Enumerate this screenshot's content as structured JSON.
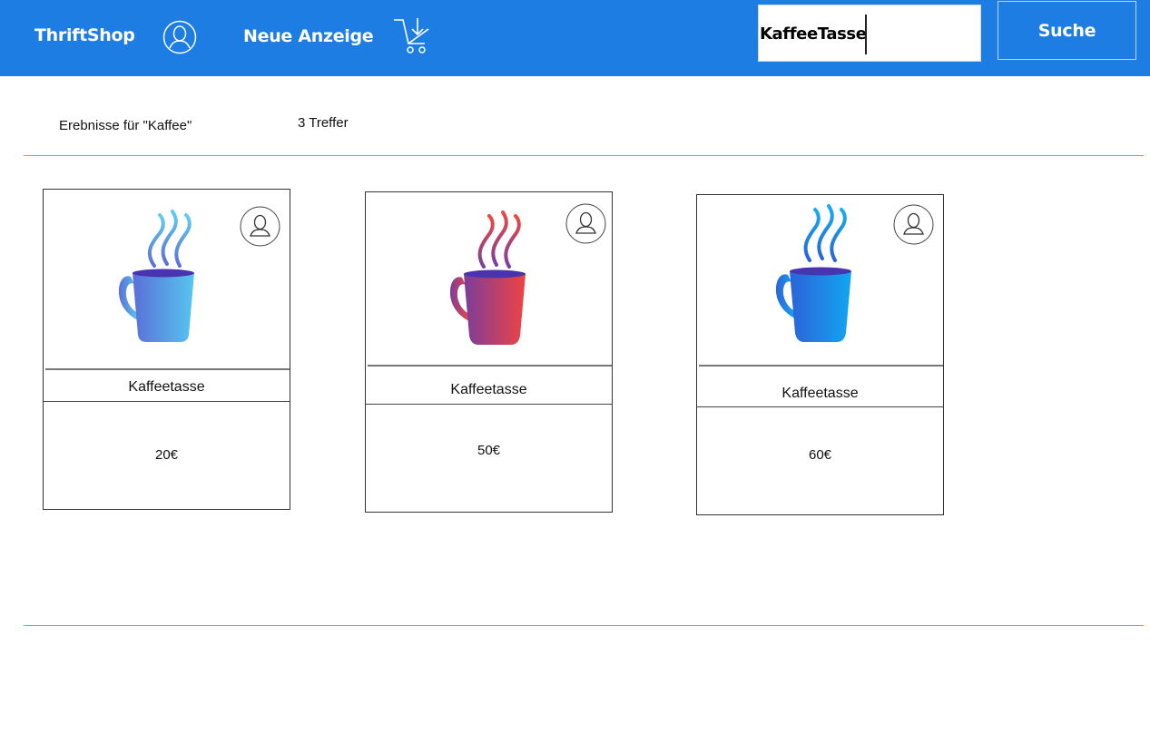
{
  "header": {
    "brand": "ThriftShop",
    "profile_icon": "user-circle-icon",
    "new_ad_label": "Neue Anzeige",
    "cart_icon": "cart-download-icon",
    "search_value": "KaffeeTasse",
    "search_button": "Suche"
  },
  "results": {
    "label": "Erebnisse für \"Kaffee\"",
    "count": "3 Treffer"
  },
  "items": [
    {
      "title": "Kaffeetasse",
      "price": "20€",
      "mug_color": "light-blue",
      "seller_icon": "user-icon"
    },
    {
      "title": "Kaffeetasse",
      "price": "50€",
      "mug_color": "red-purple",
      "seller_icon": "user-icon"
    },
    {
      "title": "Kaffeetasse",
      "price": "60€",
      "mug_color": "blue",
      "seller_icon": "user-icon"
    }
  ],
  "colors": {
    "header_bg": "#1e7de3",
    "divider": "#6aa8e8"
  }
}
